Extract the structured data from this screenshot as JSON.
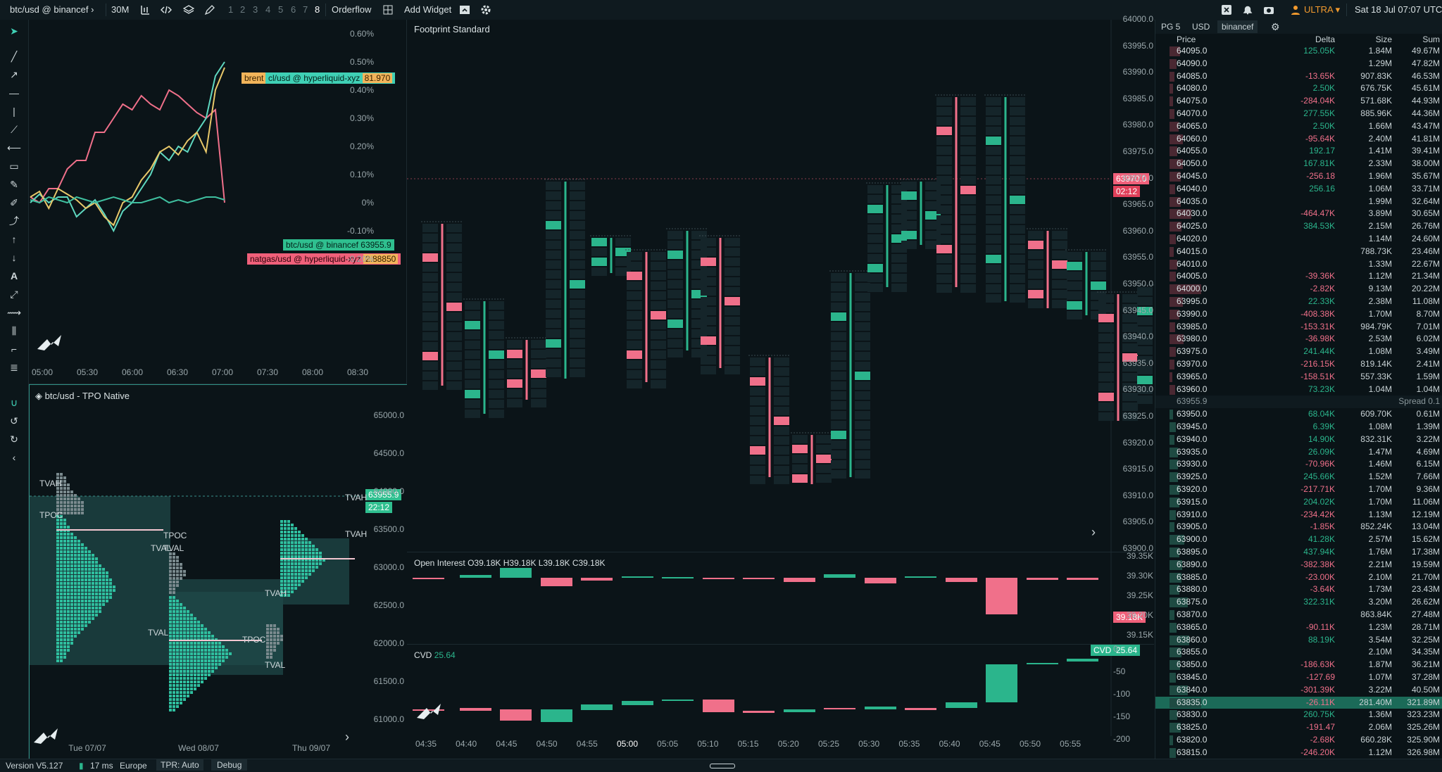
{
  "topbar": {
    "symbol": "btc/usd @ binancef",
    "timeframe": "30M",
    "layouts": [
      "1",
      "2",
      "3",
      "4",
      "5",
      "6",
      "7",
      "8"
    ],
    "orderflow": "Orderflow",
    "add_widget": "Add Widget",
    "plan": "ULTRA",
    "datetime": "Sat 18 Jul  07:07  UTC"
  },
  "chart1": {
    "y_ticks": [
      "0.60%",
      "0.50%",
      "0.40%",
      "0.30%",
      "0.20%",
      "0.10%",
      "0%",
      "-0.10%",
      "-0.20%"
    ],
    "x_ticks": [
      "05:00",
      "05:30",
      "06:00",
      "06:30",
      "07:00",
      "07:30",
      "08:00",
      "08:30"
    ],
    "tags": [
      {
        "label": "brent",
        "color": "#f2b45a"
      },
      {
        "label": "cl/usd @ hyperliquid-xyz",
        "value": "81.970",
        "color": "#3fd0b5"
      },
      {
        "label": "btc/usd @ binancef",
        "value": "63955.9",
        "color": "#2fbf8f"
      },
      {
        "label": "natgas/usd @ hyperliquid-xyz",
        "value": "2.88850",
        "color": "#f0607a"
      }
    ],
    "chart_data": {
      "type": "line",
      "ylim": [
        -0.25,
        0.62
      ],
      "series": [
        {
          "name": "natgas/usd @ hyperliquid-xyz",
          "color": "#f0708a",
          "values": [
            0.02,
            0.0,
            0.05,
            0.05,
            0.12,
            0.15,
            0.15,
            0.25,
            0.25,
            0.3,
            0.35,
            0.33,
            0.38,
            0.35,
            0.33,
            0.4,
            0.38,
            0.35,
            0.32,
            0.3,
            0.33,
            0.0
          ]
        },
        {
          "name": "cl/usd @ hyperliquid-xyz",
          "color": "#5fd8c0",
          "values": [
            0.0,
            0.03,
            0.0,
            0.02,
            0.02,
            -0.05,
            -0.02,
            0.01,
            -0.04,
            -0.1,
            -0.03,
            0.0,
            0.05,
            0.1,
            0.18,
            0.15,
            0.2,
            0.18,
            0.25,
            0.3,
            0.45,
            0.5
          ]
        },
        {
          "name": "brent",
          "color": "#e8c86a",
          "values": [
            0.02,
            0.04,
            -0.02,
            0.05,
            0.03,
            0.01,
            -0.02,
            0.0,
            -0.05,
            -0.08,
            0.0,
            0.02,
            0.08,
            0.12,
            0.18,
            0.2,
            0.17,
            0.22,
            0.25,
            0.18,
            0.4,
            0.48
          ]
        },
        {
          "name": "btc/usd @ binancef",
          "color": "#3fbf9f",
          "values": [
            0.01,
            0.0,
            0.02,
            0.01,
            0.0,
            0.02,
            0.01,
            0.0,
            0.01,
            0.02,
            0.01,
            0.0,
            0.0,
            0.01,
            0.02,
            0.0,
            0.01,
            0.0,
            0.01,
            0.02,
            0.02,
            0.01
          ]
        }
      ]
    }
  },
  "tpo": {
    "title": "btc/usd - TPO Native",
    "y_ticks": [
      "65000.0",
      "64500.0",
      "64000.0",
      "63500.0",
      "63000.0",
      "62500.0",
      "62000.0",
      "61500.0",
      "61000.0"
    ],
    "x_ticks": [
      "Tue 07/07",
      "Wed 08/07",
      "Thu 09/07"
    ],
    "price_tag": "63955.9",
    "timer_tag": "22:12",
    "labels": [
      "TVAH",
      "TPOC",
      "TVAL",
      "TVAH",
      "TPOC",
      "TVAL",
      "TVAH",
      "TPOC",
      "TVAL",
      "TVAH",
      "TVAL"
    ]
  },
  "footprint": {
    "title": "Footprint Standard",
    "y_ticks": [
      "64000.0",
      "63995.0",
      "63990.0",
      "63985.0",
      "63980.0",
      "63975.0",
      "63970.0",
      "63965.0",
      "63960.0",
      "63955.0",
      "63950.0",
      "63945.0",
      "63940.0",
      "63935.0",
      "63930.0",
      "63925.0",
      "63920.0",
      "63915.0",
      "63910.0",
      "63905.0",
      "63900.0"
    ],
    "price_tag": "63970.0",
    "timer_tag": "02:12"
  },
  "oi": {
    "title": "Open Interest",
    "ohlc": "O39.18K  H39.18K  L39.18K  C39.18K",
    "y_ticks": [
      "39.35K",
      "39.30K",
      "39.25K",
      "39.20K",
      "39.15K"
    ],
    "price_tag": "39.18K"
  },
  "cvd": {
    "title": "CVD",
    "value": "25.64",
    "tag_label": "CVD",
    "tag_value": "25.64",
    "y_ticks": [
      "0",
      "-50",
      "-100",
      "-150",
      "-200"
    ],
    "x_ticks": [
      "04:35",
      "04:40",
      "04:45",
      "04:50",
      "04:55",
      "05:00",
      "05:05",
      "05:10",
      "05:15",
      "05:20",
      "05:25",
      "05:30",
      "05:35",
      "05:40",
      "05:45",
      "05:50",
      "05:55"
    ]
  },
  "orderbook": {
    "tabs": [
      "PG 5",
      "USD",
      "binancef"
    ],
    "headers": [
      "Price",
      "Delta",
      "Size",
      "Sum"
    ],
    "asks": [
      [
        "64095.0",
        "125.05K",
        "1.84M",
        "49.67M"
      ],
      [
        "64090.0",
        "",
        "1.29M",
        "47.82M"
      ],
      [
        "64085.0",
        "-13.65K",
        "907.83K",
        "46.53M"
      ],
      [
        "64080.0",
        "2.50K",
        "676.75K",
        "45.61M"
      ],
      [
        "64075.0",
        "-284.04K",
        "571.68K",
        "44.93M"
      ],
      [
        "64070.0",
        "277.55K",
        "885.96K",
        "44.36M"
      ],
      [
        "64065.0",
        "2.50K",
        "1.66M",
        "43.47M"
      ],
      [
        "64060.0",
        "-95.64K",
        "2.40M",
        "41.81M"
      ],
      [
        "64055.0",
        "192.17",
        "1.41M",
        "39.41M"
      ],
      [
        "64050.0",
        "167.81K",
        "2.33M",
        "38.00M"
      ],
      [
        "64045.0",
        "-256.18",
        "1.96M",
        "35.67M"
      ],
      [
        "64040.0",
        "256.16",
        "1.06M",
        "33.71M"
      ],
      [
        "64035.0",
        "",
        "1.99M",
        "32.64M"
      ],
      [
        "64030.0",
        "-464.47K",
        "3.89M",
        "30.65M"
      ],
      [
        "64025.0",
        "384.53K",
        "2.15M",
        "26.76M"
      ],
      [
        "64020.0",
        "",
        "1.14M",
        "24.60M"
      ],
      [
        "64015.0",
        "",
        "788.73K",
        "23.46M"
      ],
      [
        "64010.0",
        "",
        "1.33M",
        "22.67M"
      ],
      [
        "64005.0",
        "-39.36K",
        "1.12M",
        "21.34M"
      ],
      [
        "64000.0",
        "-2.82K",
        "9.13M",
        "20.22M"
      ],
      [
        "63995.0",
        "22.33K",
        "2.38M",
        "11.08M"
      ],
      [
        "63990.0",
        "-408.38K",
        "1.70M",
        "8.70M"
      ],
      [
        "63985.0",
        "-153.31K",
        "984.79K",
        "7.01M"
      ],
      [
        "63980.0",
        "-36.98K",
        "2.53M",
        "6.02M"
      ],
      [
        "63975.0",
        "241.44K",
        "1.08M",
        "3.49M"
      ],
      [
        "63970.0",
        "-216.15K",
        "819.14K",
        "2.41M"
      ],
      [
        "63965.0",
        "-158.51K",
        "557.33K",
        "1.59M"
      ],
      [
        "63960.0",
        "73.23K",
        "1.04M",
        "1.04M"
      ]
    ],
    "spread_price": "63955.9",
    "spread_label": "Spread 0.1",
    "bids": [
      [
        "63950.0",
        "68.04K",
        "609.70K",
        "0.61M"
      ],
      [
        "63945.0",
        "6.39K",
        "1.08M",
        "1.39M"
      ],
      [
        "63940.0",
        "14.90K",
        "832.31K",
        "3.22M"
      ],
      [
        "63935.0",
        "26.09K",
        "1.47M",
        "4.69M"
      ],
      [
        "63930.0",
        "-70.96K",
        "1.46M",
        "6.15M"
      ],
      [
        "63925.0",
        "245.66K",
        "1.52M",
        "7.66M"
      ],
      [
        "63920.0",
        "-217.71K",
        "1.70M",
        "9.36M"
      ],
      [
        "63915.0",
        "204.02K",
        "1.70M",
        "11.06M"
      ],
      [
        "63910.0",
        "-234.42K",
        "1.13M",
        "12.19M"
      ],
      [
        "63905.0",
        "-1.85K",
        "852.24K",
        "13.04M"
      ],
      [
        "63900.0",
        "41.28K",
        "2.57M",
        "15.62M"
      ],
      [
        "63895.0",
        "437.94K",
        "1.76M",
        "17.38M"
      ],
      [
        "63890.0",
        "-382.38K",
        "2.21M",
        "19.59M"
      ],
      [
        "63885.0",
        "-23.00K",
        "2.10M",
        "21.70M"
      ],
      [
        "63880.0",
        "-3.64K",
        "1.73M",
        "23.43M"
      ],
      [
        "63875.0",
        "322.31K",
        "3.20M",
        "26.62M"
      ],
      [
        "63870.0",
        "",
        "863.84K",
        "27.48M"
      ],
      [
        "63865.0",
        "-90.11K",
        "1.23M",
        "28.71M"
      ],
      [
        "63860.0",
        "88.19K",
        "3.54M",
        "32.25M"
      ],
      [
        "63855.0",
        "",
        "2.10M",
        "34.35M"
      ],
      [
        "63850.0",
        "-186.63K",
        "1.87M",
        "36.21M"
      ],
      [
        "63845.0",
        "-127.69",
        "1.07M",
        "37.28M"
      ],
      [
        "63840.0",
        "-301.39K",
        "3.22M",
        "40.50M"
      ],
      [
        "63835.0",
        "-26.11K",
        "281.40M",
        "321.89M"
      ],
      [
        "63830.0",
        "260.75K",
        "1.36M",
        "323.23M"
      ],
      [
        "63825.0",
        "-191.47",
        "2.06M",
        "325.26M"
      ],
      [
        "63820.0",
        "-2.68K",
        "660.28K",
        "325.90M"
      ],
      [
        "63815.0",
        "-246.20K",
        "1.12M",
        "326.98M"
      ]
    ]
  },
  "status": {
    "version": "Version V5.127",
    "latency": "17 ms",
    "region": "Europe",
    "tpr": "TPR: Auto",
    "debug": "Debug"
  },
  "colors": {
    "bull": "#2bb58c",
    "bear": "#f0708a",
    "bg": "#0b1418",
    "accent": "#f29a2e"
  }
}
